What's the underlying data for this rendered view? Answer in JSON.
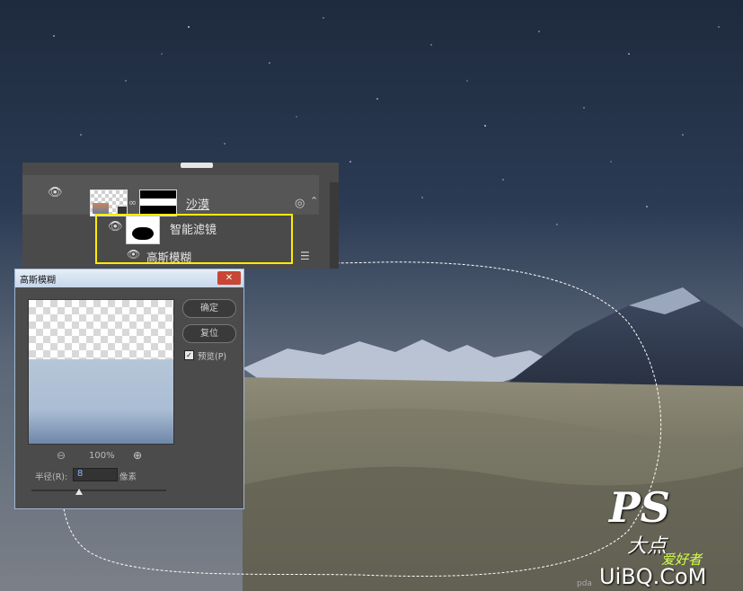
{
  "layers_panel": {
    "layer_name": "沙漠",
    "smart_filters_label": "智能滤镜",
    "filter_name": "高斯模糊"
  },
  "dialog": {
    "title": "高斯模糊",
    "close": "✕",
    "ok_label": "确定",
    "reset_label": "复位",
    "preview_label": "预览(P)",
    "preview_checked": true,
    "zoom_level": "100%",
    "radius_label": "半径(R):",
    "radius_value": "8",
    "radius_unit": "像素",
    "slider_fraction": 0.35
  },
  "watermark": {
    "main": "PS",
    "sub": "大点",
    "hobby": "爱好者",
    "site": "UiBQ.CoM",
    "site_prefix": "pda"
  },
  "colors": {
    "highlight": "#ffec00",
    "sky": "#2b3a52",
    "panel": "#4a4a4a"
  }
}
